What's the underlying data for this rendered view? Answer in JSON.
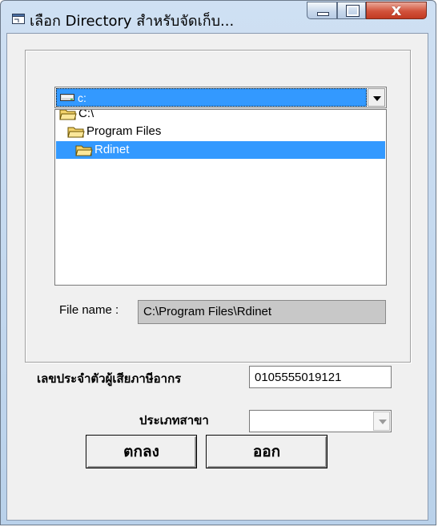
{
  "window": {
    "title": "เลือก Directory สำหรับจัดเก็บ...",
    "controls": {
      "minimize": "minimize",
      "maximize": "maximize",
      "close": "x"
    }
  },
  "drive": {
    "selected": "c:"
  },
  "directories": [
    {
      "label": "C:\\",
      "selected": false
    },
    {
      "label": "Program Files",
      "selected": false
    },
    {
      "label": "Rdinet",
      "selected": true
    }
  ],
  "file_name": {
    "label": "File name :",
    "value": "C:\\Program Files\\Rdinet"
  },
  "tax_id": {
    "label": "เลขประจำตัวผู้เสียภาษีอากร",
    "value": "0105555019121"
  },
  "branch_type": {
    "label": "ประเภทสาขา",
    "value": ""
  },
  "buttons": {
    "ok": "ตกลง",
    "exit": "ออก"
  },
  "colors": {
    "selection": "#3399ff",
    "titlebar": "#c4d8ee",
    "close": "#c8452e"
  }
}
